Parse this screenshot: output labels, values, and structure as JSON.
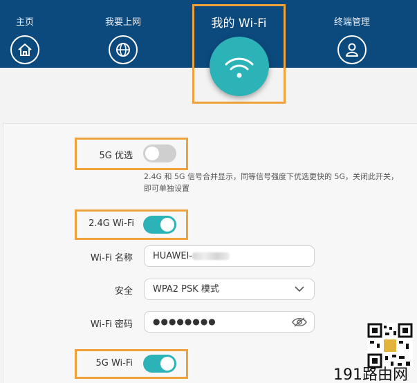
{
  "nav": {
    "home": {
      "label": "主页",
      "icon": "home-icon"
    },
    "internet": {
      "label": "我要上网",
      "icon": "globe-icon"
    },
    "wifi": {
      "label": "我的 Wi-Fi",
      "icon": "wifi-icon"
    },
    "devices": {
      "label": "终端管理",
      "icon": "user-icon"
    }
  },
  "settings": {
    "prefer5g": {
      "label": "5G 优选",
      "enabled": false,
      "description": "2.4G 和 5G 信号合并显示，同等信号强度下优选更快的 5G，关闭此开关，即可单独设置"
    },
    "wifi24": {
      "label": "2.4G Wi-Fi",
      "enabled": true
    },
    "ssid": {
      "label": "Wi-Fi 名称",
      "value": "HUAWEI-"
    },
    "security": {
      "label": "安全",
      "value": "WPA2 PSK 模式"
    },
    "password": {
      "label": "Wi-Fi 密码",
      "value": "●●●●●●●●"
    },
    "wifi5": {
      "label": "5G Wi-Fi",
      "enabled": true
    }
  },
  "watermark": {
    "text": "191路由网"
  },
  "colors": {
    "header": "#0c4a7e",
    "accent": "#2bb3b8",
    "highlight": "#f0a23a"
  }
}
